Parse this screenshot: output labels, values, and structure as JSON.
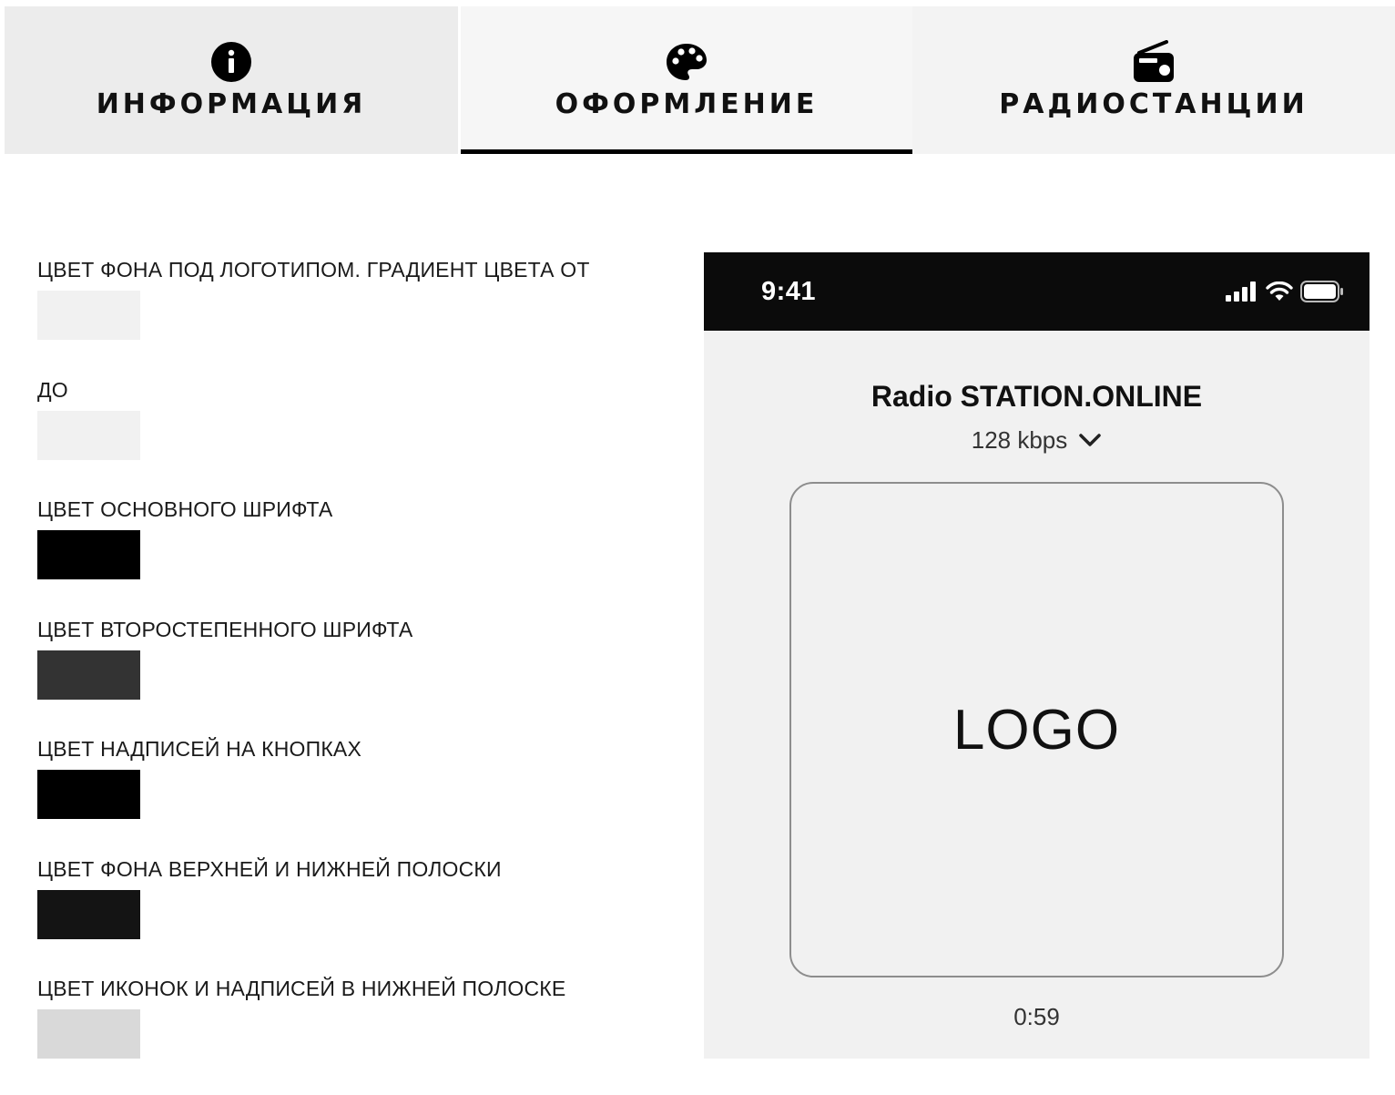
{
  "tabs": [
    {
      "label": "ИНФОРМАЦИЯ",
      "icon": "info-icon",
      "active": false
    },
    {
      "label": "ОФОРМЛЕНИЕ",
      "icon": "palette-icon",
      "active": true
    },
    {
      "label": "РАДИОСТАНЦИИ",
      "icon": "radio-icon",
      "active": false
    }
  ],
  "settings": [
    {
      "label": "ЦВЕТ ФОНА ПОД ЛОГОТИПОМ. ГРАДИЕНТ ЦВЕТА ОТ",
      "color": "#f1f1f1"
    },
    {
      "label": "ДО",
      "color": "#f1f1f1"
    },
    {
      "label": "ЦВЕТ ОСНОВНОГО ШРИФТА",
      "color": "#000000"
    },
    {
      "label": "ЦВЕТ ВТОРОСТЕПЕННОГО ШРИФТА",
      "color": "#333333"
    },
    {
      "label": "ЦВЕТ НАДПИСЕЙ НА КНОПКАХ",
      "color": "#000000"
    },
    {
      "label": "ЦВЕТ ФОНА ВЕРХНЕЙ И НИЖНЕЙ ПОЛОСКИ",
      "color": "#141414"
    },
    {
      "label": "ЦВЕТ ИКОНОК И НАДПИСЕЙ В НИЖНЕЙ ПОЛОСКЕ",
      "color": "#d9d9d9"
    }
  ],
  "preview": {
    "time": "9:41",
    "station_title": "Radio STATION.ONLINE",
    "bitrate": "128 kbps",
    "logo_text": "LOGO",
    "elapsed": "0:59",
    "statusbar_color": "#0b0b0b",
    "background_color": "#f1f1f1"
  }
}
